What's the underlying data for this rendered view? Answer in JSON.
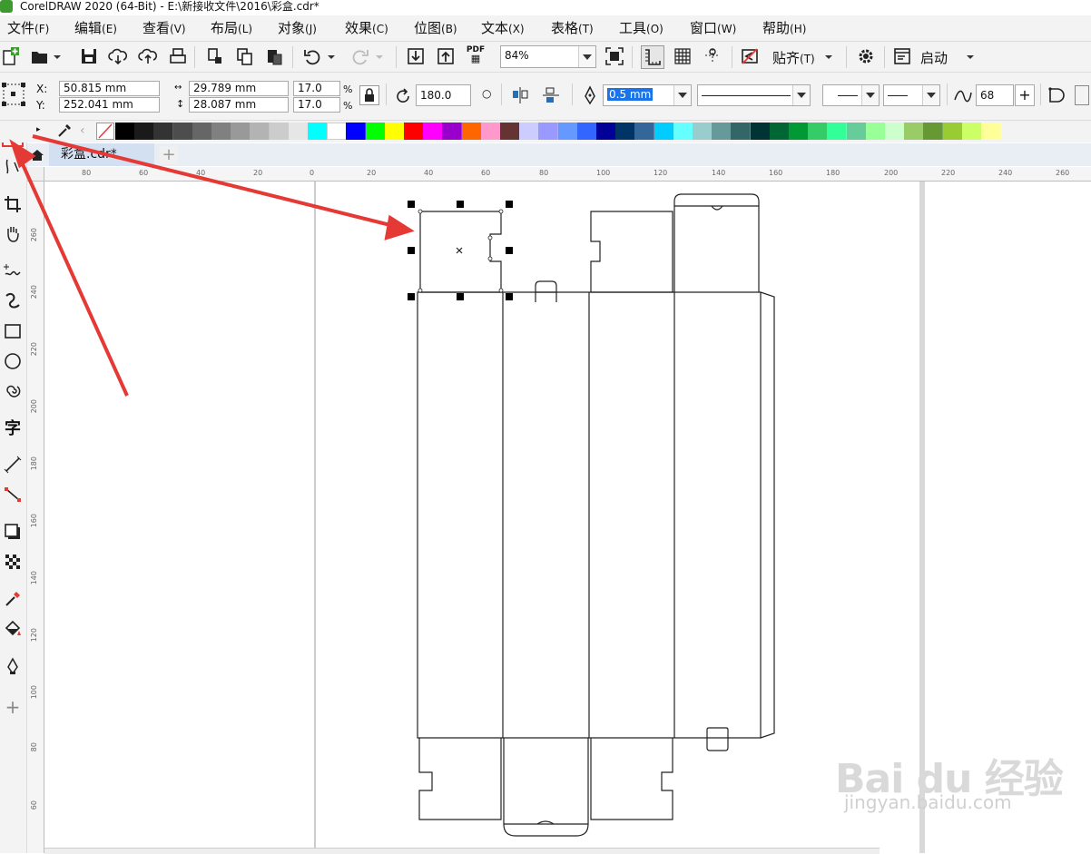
{
  "window": {
    "title": "CorelDRAW 2020 (64-Bit) - E:\\新接收文件\\2016\\彩盒.cdr*"
  },
  "menu": [
    {
      "label": "文件",
      "acc": "(F)"
    },
    {
      "label": "编辑",
      "acc": "(E)"
    },
    {
      "label": "查看",
      "acc": "(V)"
    },
    {
      "label": "布局",
      "acc": "(L)"
    },
    {
      "label": "对象",
      "acc": "(J)"
    },
    {
      "label": "效果",
      "acc": "(C)"
    },
    {
      "label": "位图",
      "acc": "(B)"
    },
    {
      "label": "文本",
      "acc": "(X)"
    },
    {
      "label": "表格",
      "acc": "(T)"
    },
    {
      "label": "工具",
      "acc": "(O)"
    },
    {
      "label": "窗口",
      "acc": "(W)"
    },
    {
      "label": "帮助",
      "acc": "(H)"
    }
  ],
  "toolbar": {
    "zoom": "84%",
    "snap_label": "贴齐",
    "snap_acc": "(T)",
    "launch_label": "启动",
    "pdf_label": "PDF"
  },
  "propbar": {
    "x_label": "X:",
    "y_label": "Y:",
    "x_value": "50.815 mm",
    "y_value": "252.041 mm",
    "width_value": "29.789 mm",
    "height_value": "28.087 mm",
    "scale_w": "17.0",
    "scale_h": "17.0",
    "percent": "%",
    "rotation": "180.0",
    "outline_width": "0.5 mm",
    "smooth_value": "68"
  },
  "palette": [
    "#000000",
    "#1a1a1a",
    "#333333",
    "#4d4d4d",
    "#666666",
    "#808080",
    "#999999",
    "#b3b3b3",
    "#cccccc",
    "#e6e6e6",
    "#00ffff",
    "#ffffff",
    "#0000ff",
    "#00ff00",
    "#ffff00",
    "#ff0000",
    "#ff00ff",
    "#9900cc",
    "#ff6600",
    "#ff99cc",
    "#663333",
    "#ccccff",
    "#9999ff",
    "#6699ff",
    "#3366ff",
    "#000099",
    "#003366",
    "#336699",
    "#00ccff",
    "#66ffff",
    "#99cccc",
    "#669999",
    "#336666",
    "#003333",
    "#006633",
    "#009933",
    "#33cc66",
    "#33ff99",
    "#66cc99",
    "#99ff99",
    "#ccffcc",
    "#99cc66",
    "#669933",
    "#99cc33",
    "#ccff66",
    "#ffff99"
  ],
  "doc_tab": {
    "name": "彩盒.cdr*"
  },
  "ruler_h": [
    "80",
    "60",
    "40",
    "20",
    "0",
    "20",
    "40",
    "60",
    "80",
    "100",
    "120",
    "140",
    "160",
    "180",
    "200",
    "220",
    "240",
    "260"
  ],
  "ruler_v": [
    "260",
    "240",
    "220",
    "200",
    "180",
    "160",
    "140",
    "120",
    "100",
    "80",
    "60"
  ],
  "watermark": {
    "brand": "Bai du 经验",
    "url": "jingyan.baidu.com"
  },
  "colors": {
    "accent_red": "#e53935",
    "selection": "#000000"
  }
}
